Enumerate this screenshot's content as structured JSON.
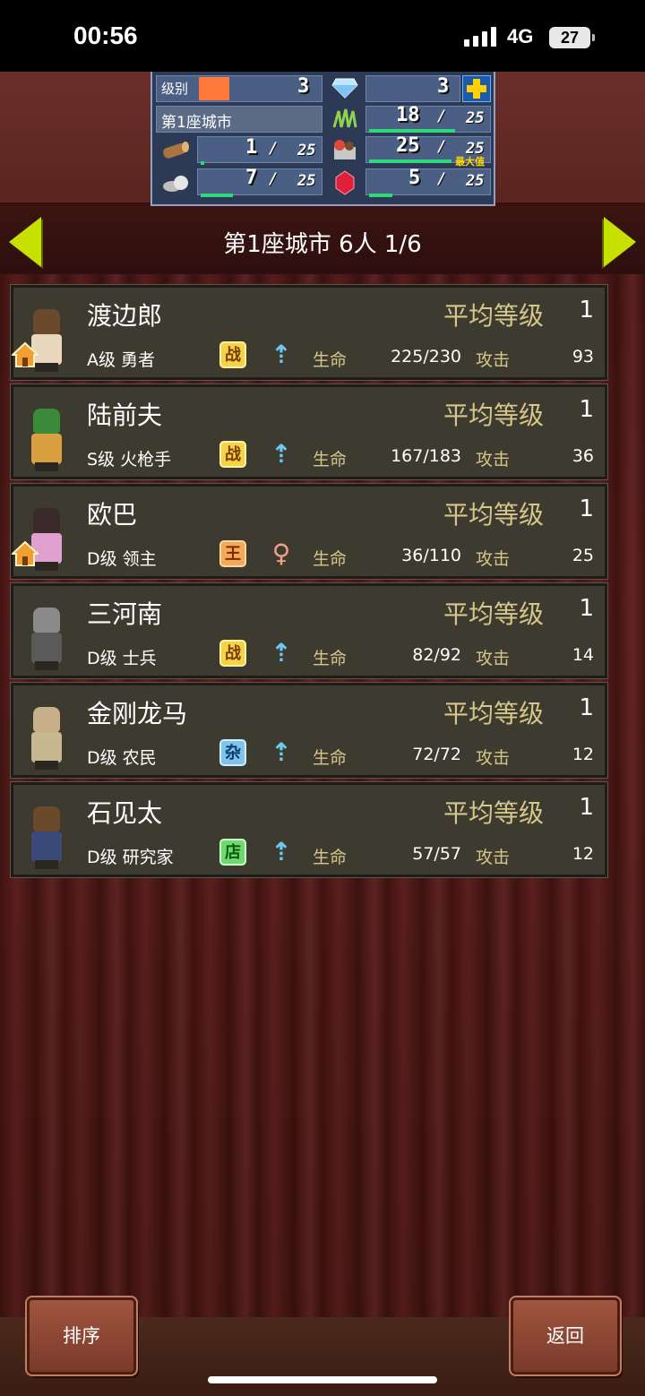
{
  "status": {
    "time": "00:56",
    "network": "4G",
    "battery": "27"
  },
  "resources": {
    "level_label": "级别",
    "level": "3",
    "gems": "3",
    "city_name": "第1座城市",
    "rows": [
      {
        "name": "wood",
        "value": "1",
        "max": "25",
        "fill": 0.04
      },
      {
        "name": "stone",
        "value": "7",
        "max": "25",
        "fill": 0.28
      },
      {
        "name": "grass",
        "value": "18",
        "max": "25",
        "fill": 0.72
      },
      {
        "name": "food",
        "value": "25",
        "max": "25",
        "fill": 1.0,
        "note": "最大值"
      },
      {
        "name": "ruby",
        "value": "5",
        "max": "25",
        "fill": 0.2
      }
    ],
    "sep": "/"
  },
  "header": {
    "title": "第1座城市  6人 1/6"
  },
  "labels": {
    "avg_level": "平均等级",
    "hp": "生命",
    "atk": "攻击"
  },
  "characters": [
    {
      "name": "渡边郎",
      "avg_level": "1",
      "rank": "A级 勇者",
      "job": "战",
      "gender": "male",
      "hp": "225/230",
      "atk": "93",
      "home": true
    },
    {
      "name": "陆前夫",
      "avg_level": "1",
      "rank": "S级 火枪手",
      "job": "战",
      "gender": "male",
      "hp": "167/183",
      "atk": "36",
      "home": false
    },
    {
      "name": "欧巴",
      "avg_level": "1",
      "rank": "D级 领主",
      "job": "王",
      "gender": "female",
      "hp": "36/110",
      "atk": "25",
      "home": true
    },
    {
      "name": "三河南",
      "avg_level": "1",
      "rank": "D级 士兵",
      "job": "战",
      "gender": "male",
      "hp": "82/92",
      "atk": "14",
      "home": false
    },
    {
      "name": "金刚龙马",
      "avg_level": "1",
      "rank": "D级 农民",
      "job": "杂",
      "gender": "male",
      "hp": "72/72",
      "atk": "12",
      "home": false
    },
    {
      "name": "石见太",
      "avg_level": "1",
      "rank": "D级 研究家",
      "job": "店",
      "gender": "male",
      "hp": "57/57",
      "atk": "12",
      "home": false
    }
  ],
  "buttons": {
    "sort": "排序",
    "back": "返回"
  },
  "colors": {
    "accent": "#c8e000",
    "gold_text": "#d6c68a",
    "row_bg": "#3d3b30"
  }
}
